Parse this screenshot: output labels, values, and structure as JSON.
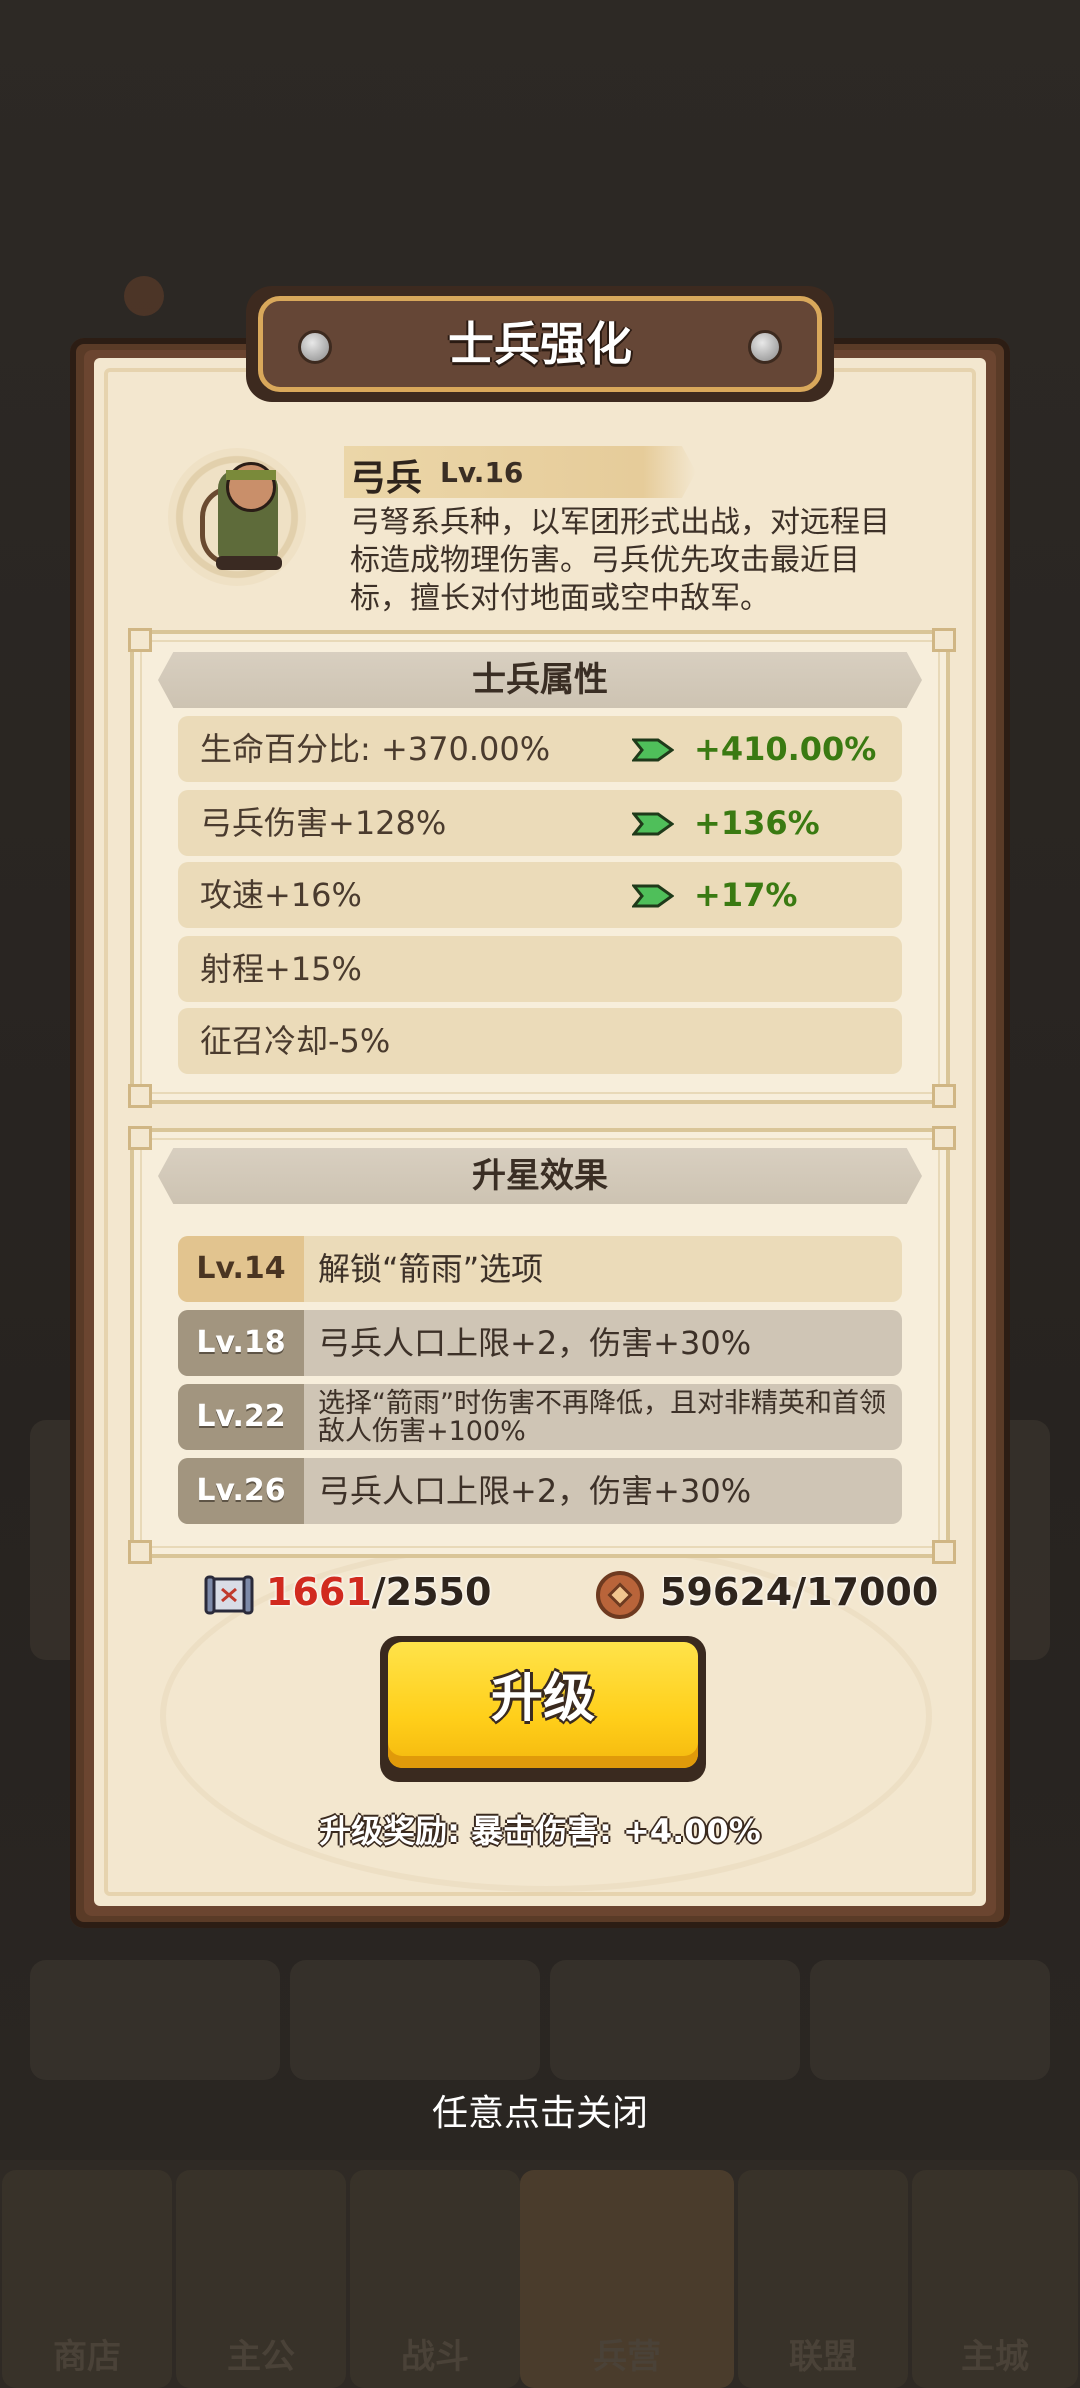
{
  "dialog": {
    "title": "士兵强化"
  },
  "unit": {
    "name": "弓兵",
    "level": "Lv.16",
    "description": "弓弩系兵种，以军团形式出战，对远程目标造成物理伤害。弓兵优先攻击最近目标，擅长对付地面或空中敌军。"
  },
  "attributes": {
    "title": "士兵属性",
    "rows": [
      {
        "label": "生命百分比: +370.00%",
        "next": "+410.00%"
      },
      {
        "label": "弓兵伤害+128%",
        "next": "+136%"
      },
      {
        "label": "攻速+16%",
        "next": "+17%"
      },
      {
        "label": "射程+15%",
        "next": ""
      },
      {
        "label": "征召冷却-5%",
        "next": ""
      }
    ]
  },
  "star_effects": {
    "title": "升星效果",
    "rows": [
      {
        "level": "Lv.14",
        "text": "解锁“箭雨”选项",
        "state": "unlocked"
      },
      {
        "level": "Lv.18",
        "text": "弓兵人口上限+2，伤害+30%",
        "state": "locked"
      },
      {
        "level": "Lv.22",
        "text": "选择“箭雨”时伤害不再降低，且对非精英和首领敌人伤害+100%",
        "state": "locked"
      },
      {
        "level": "Lv.26",
        "text": "弓兵人口上限+2，伤害+30%",
        "state": "locked"
      }
    ]
  },
  "resources": {
    "scroll_have": "1661",
    "scroll_need": "/2550",
    "coin": "59624/17000"
  },
  "upgrade": {
    "button_label": "升级",
    "reward": "升级奖励: 暴击伤害: +4.00%"
  },
  "close_hint": "任意点击关闭",
  "background_tabs": [
    "商店",
    "主公",
    "战斗",
    "兵营",
    "联盟",
    "主城"
  ],
  "colors": {
    "next_value": "#3a7a12",
    "insufficient": "#d12a1f",
    "button": "#ffcf1a"
  },
  "icons": {
    "arrow": "green-arrow-icon",
    "scroll": "scroll-icon",
    "coin": "coin-icon",
    "bolt": "rivet-icon"
  }
}
